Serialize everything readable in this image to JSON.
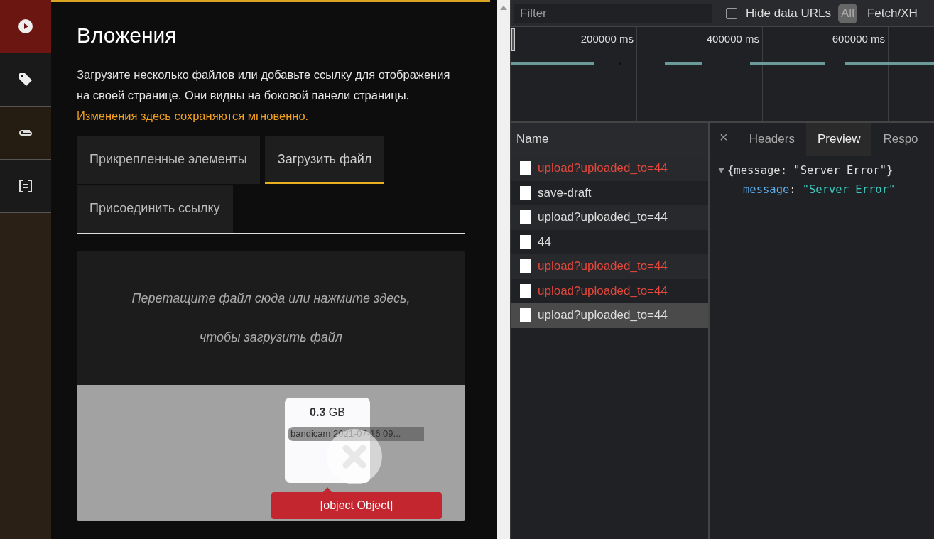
{
  "sidebar": {
    "items": [
      {
        "kind": "play",
        "selected": true
      },
      {
        "kind": "tag",
        "selected": false
      },
      {
        "kind": "paperclip",
        "selected": false
      },
      {
        "kind": "form",
        "selected": false
      }
    ]
  },
  "panel": {
    "title": "Вложения",
    "description": "Загрузите несколько файлов или добавьте ссылку для отображения на своей странице. Они видны на боковой панели страницы.",
    "note": "Изменения здесь сохраняются мгновенно.",
    "tabs": [
      {
        "label": "Прикрепленные элементы",
        "selected": false
      },
      {
        "label": "Загрузить файл",
        "selected": true
      },
      {
        "label": "Присоединить ссылку",
        "selected": false
      }
    ],
    "dropzone": {
      "lines": [
        "Перетащите файл сюда или нажмите здесь,",
        "чтобы загрузить файл"
      ],
      "file": {
        "size": "**0.3** GB",
        "name": "bandicam 2021-07-16 09...",
        "error": "[object Object]"
      }
    }
  },
  "devtools": {
    "filter": {
      "placeholder": "Filter"
    },
    "hide_data_urls": {
      "label": "Hide data URLs",
      "checked": false
    },
    "type_filters": [
      {
        "label": "All",
        "selected": true
      },
      {
        "label": "Fetch/XH",
        "selected": false
      }
    ],
    "timeline": {
      "ticks": [
        "200000 ms",
        "400000 ms",
        "600000 ms"
      ]
    },
    "requests": {
      "column": "Name",
      "rows": [
        {
          "name": "upload?uploaded_to=44",
          "failed": true,
          "selected": false
        },
        {
          "name": "save-draft",
          "failed": false,
          "selected": false
        },
        {
          "name": "upload?uploaded_to=44",
          "failed": false,
          "selected": false
        },
        {
          "name": "44",
          "failed": false,
          "selected": false
        },
        {
          "name": "upload?uploaded_to=44",
          "failed": true,
          "selected": false
        },
        {
          "name": "upload?uploaded_to=44",
          "failed": true,
          "selected": false
        },
        {
          "name": "upload?uploaded_to=44",
          "failed": false,
          "selected": true
        }
      ]
    },
    "detail": {
      "close": "×",
      "tabs": [
        {
          "label": "Headers",
          "selected": false
        },
        {
          "label": "Preview",
          "selected": true
        },
        {
          "label": "Respo",
          "selected": false
        }
      ],
      "preview": {
        "summary": "{message: \"Server Error\"}",
        "expanded": true,
        "key": "message",
        "separator": ":",
        "value": "\"Server Error\""
      }
    }
  }
}
